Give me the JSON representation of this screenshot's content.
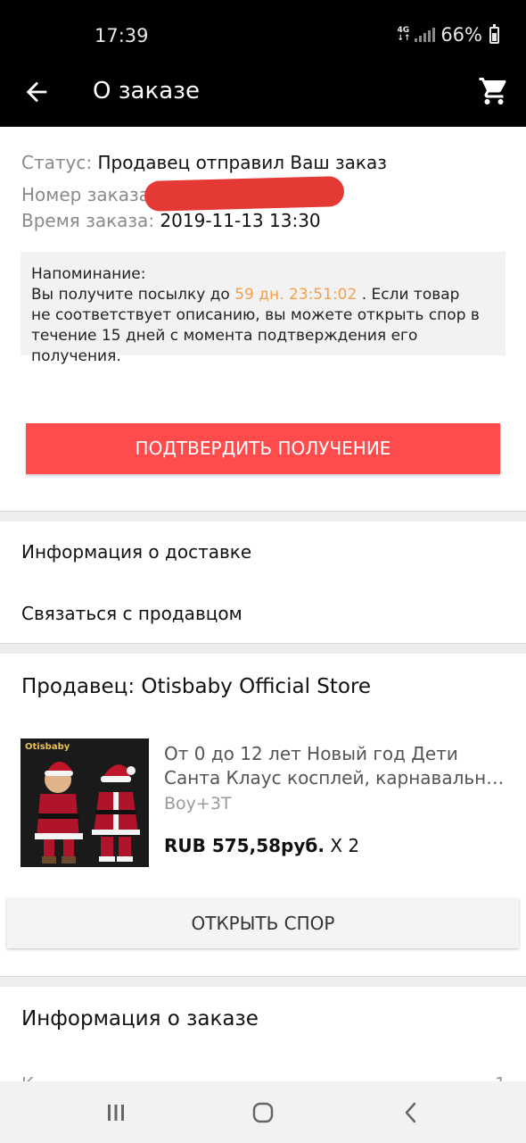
{
  "status_bar": {
    "time": "17:39",
    "network_top": "4G",
    "network_bottom": "↓↑",
    "battery": "66%"
  },
  "app_bar": {
    "title": "О заказе",
    "back_icon": "arrow-back-icon",
    "cart_icon": "cart-icon"
  },
  "order": {
    "status_label": "Статус:",
    "status_value": "Продавец отправил Ваш заказ",
    "number_label": "Номер заказа:",
    "number_value": "",
    "time_label": "Время заказа:",
    "time_value": "2019-11-13 13:30"
  },
  "reminder": {
    "heading": "Напоминание:",
    "text_before": "Вы получите посылку до ",
    "countdown": "59 дн. 23:51:02",
    "text_after_line1": " . Если товар",
    "text_line2": "не соответствует описанию, вы можете открыть спор в",
    "text_line3": "течение 15 дней с момента подтверждения его получения.",
    "highlight_color": "#f5a04a"
  },
  "confirm_button": "ПОДТВЕРДИТЬ ПОЛУЧЕНИЕ",
  "links": {
    "delivery_info": "Информация о доставке",
    "contact_seller": "Связаться с продавцом"
  },
  "seller": {
    "label": "Продавец: Otisbaby Official Store"
  },
  "product": {
    "image_brand": "Otisbaby",
    "title_line1": "От 0 до 12 лет Новый год Дети",
    "title_line2": "Санта Клаус косплей, карнавальный костюм",
    "variant": "Boy+3T",
    "price": "RUB 575,58руб.",
    "quantity": "X 2"
  },
  "dispute_button": "ОТКРЫТЬ СПОР",
  "order_info": {
    "title": "Информация о заказе",
    "peek_left": "К",
    "peek_right": "1"
  },
  "nav_bar": {
    "recents_icon": "recents-icon",
    "home_icon": "home-icon",
    "back_icon": "nav-back-icon"
  },
  "colors": {
    "primary_button": "#ff4b4b",
    "app_bar": "#000000",
    "redaction": "#e53935"
  }
}
